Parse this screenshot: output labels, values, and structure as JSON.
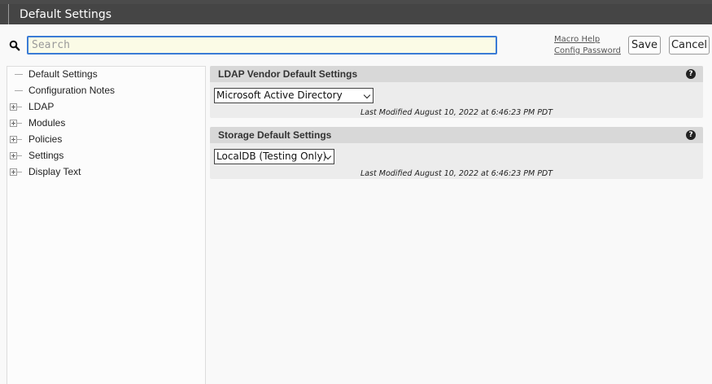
{
  "window": {
    "title": "Default Settings"
  },
  "search": {
    "placeholder": "Search"
  },
  "header_links": {
    "macro_help": "Macro Help",
    "config_password": "Config Password"
  },
  "buttons": {
    "save": "Save",
    "cancel": "Cancel"
  },
  "tree": {
    "items": [
      {
        "label": "Default Settings",
        "expandable": false
      },
      {
        "label": "Configuration Notes",
        "expandable": false
      },
      {
        "label": "LDAP",
        "expandable": true
      },
      {
        "label": "Modules",
        "expandable": true
      },
      {
        "label": "Policies",
        "expandable": true
      },
      {
        "label": "Settings",
        "expandable": true
      },
      {
        "label": "Display Text",
        "expandable": true
      }
    ]
  },
  "panels": [
    {
      "title": "LDAP Vendor Default Settings",
      "selected": "Microsoft Active Directory",
      "modified": "Last Modified August 10, 2022 at 6:46:23 PM PDT"
    },
    {
      "title": "Storage Default Settings",
      "selected": "LocalDB (Testing Only)",
      "modified": "Last Modified August 10, 2022 at 6:46:23 PM PDT"
    }
  ],
  "icons": {
    "search": "search-icon",
    "help": "help-icon",
    "expand": "plus-icon"
  },
  "colors": {
    "titlebar": "#454545",
    "search_border": "#3a7bd5",
    "panel_header": "#d8d8d8"
  }
}
